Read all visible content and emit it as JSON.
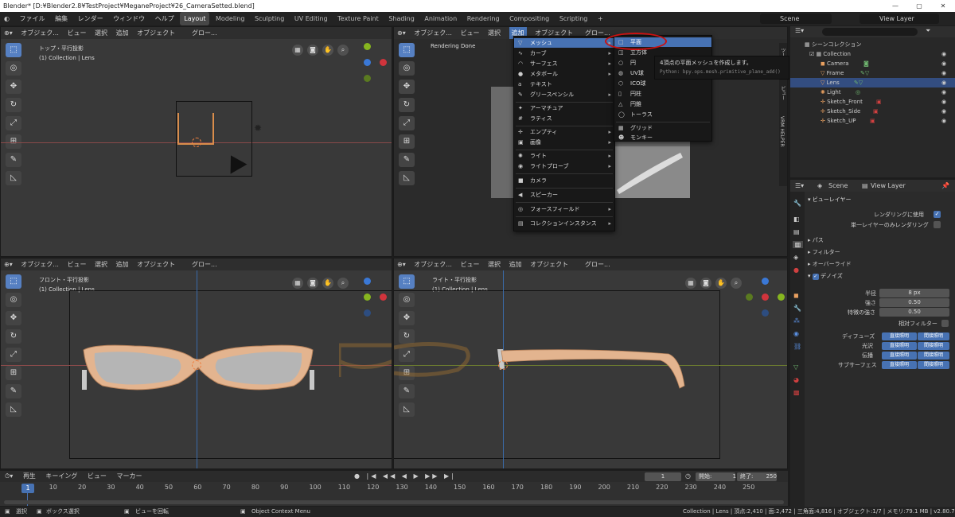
{
  "titlebar": {
    "title": "Blender* [D:¥Blender2.8¥TestProject¥MeganeProject¥26_CameraSetted.blend]",
    "minimize": "—",
    "maximize": "▢",
    "close": "✕"
  },
  "menubar": {
    "logo": "◐",
    "items": [
      "ファイル",
      "編集",
      "レンダー",
      "ウィンドウ",
      "ヘルプ"
    ],
    "workspaces": [
      "Layout",
      "Modeling",
      "Sculpting",
      "UV Editing",
      "Texture Paint",
      "Shading",
      "Animation",
      "Rendering",
      "Compositing",
      "Scripting"
    ],
    "add_tab": "+",
    "scene": "Scene",
    "view_layer": "View Layer"
  },
  "viewports": {
    "top": {
      "title": "トップ・平行投影",
      "subtitle": "(1) Collection | Lens",
      "menus": [
        "オブジェク...",
        "ビュー",
        "選択",
        "追加",
        "オブジェクト"
      ],
      "orient": "グロー..."
    },
    "camera": {
      "title": "Rendering Done",
      "menus": [
        "オブジェク...",
        "ビュー",
        "選択",
        "追加",
        "オブジェクト"
      ],
      "orient": "グロー..."
    },
    "front": {
      "title": "フロント・平行投影",
      "subtitle": "(1) Collection | Lens",
      "menus": [
        "オブジェク...",
        "ビュー",
        "選択",
        "追加",
        "オブジェクト"
      ],
      "orient": "グロー..."
    },
    "right": {
      "title": "ライト・平行投影",
      "subtitle": "(1) Collection | Lens",
      "menus": [
        "オブジェク...",
        "ビュー",
        "選択",
        "追加",
        "オブジェクト"
      ],
      "orient": "グロー..."
    }
  },
  "add_menu": {
    "items": [
      {
        "label": "メッシュ",
        "icon": "▽",
        "sub": true,
        "hl": true
      },
      {
        "label": "カーブ",
        "icon": "∿",
        "sub": true
      },
      {
        "label": "サーフェス",
        "icon": "◠",
        "sub": true
      },
      {
        "label": "メタボール",
        "icon": "●",
        "sub": true
      },
      {
        "label": "テキスト",
        "icon": "a",
        "sub": false
      },
      {
        "label": "グリースペンシル",
        "icon": "✎",
        "sub": true
      },
      {
        "label": "アーマチュア",
        "icon": "✦",
        "sub": false
      },
      {
        "label": "ラティス",
        "icon": "#",
        "sub": false
      },
      {
        "label": "エンプティ",
        "icon": "✛",
        "sub": true
      },
      {
        "label": "画像",
        "icon": "▣",
        "sub": true
      },
      {
        "label": "ライト",
        "icon": "✺",
        "sub": true
      },
      {
        "label": "ライトプローブ",
        "icon": "◉",
        "sub": true
      },
      {
        "label": "カメラ",
        "icon": "■",
        "sub": false
      },
      {
        "label": "スピーカー",
        "icon": "◀",
        "sub": false
      },
      {
        "label": "フォースフィールド",
        "icon": "◎",
        "sub": true
      },
      {
        "label": "コレクションインスタンス",
        "icon": "▤",
        "sub": true
      }
    ]
  },
  "mesh_menu": {
    "items": [
      {
        "label": "平面",
        "icon": "□"
      },
      {
        "label": "立方体",
        "icon": "◫"
      },
      {
        "label": "円",
        "icon": "○"
      },
      {
        "label": "UV球",
        "icon": "◍"
      },
      {
        "label": "ICO球",
        "icon": "⬡"
      },
      {
        "label": "円柱",
        "icon": "▯"
      },
      {
        "label": "円錐",
        "icon": "△"
      },
      {
        "label": "トーラス",
        "icon": "◯"
      },
      {
        "label": "グリッド",
        "icon": "▦"
      },
      {
        "label": "モンキー",
        "icon": "☻"
      }
    ]
  },
  "tooltip": {
    "text": "4頂点の平面メッシュを作成します。",
    "python": "Python: bpy.ops.mesh.primitive_plane_add()"
  },
  "side_tabs": [
    "ツール",
    "ビュー",
    "VRM HELPER"
  ],
  "outliner": {
    "header": "シーンコレクション",
    "rows": [
      {
        "label": "Collection",
        "indent": 1,
        "sel": false,
        "icon_color": "#ddd"
      },
      {
        "label": "Camera",
        "indent": 2,
        "sel": false,
        "icon_color": "#e8a060"
      },
      {
        "label": "Frame",
        "indent": 2,
        "sel": false,
        "icon_color": "#e8a060"
      },
      {
        "label": "Lens",
        "indent": 2,
        "sel": true,
        "icon_color": "#e8a060"
      },
      {
        "label": "Light",
        "indent": 2,
        "sel": false,
        "icon_color": "#e8a060"
      },
      {
        "label": "Sketch_Front",
        "indent": 2,
        "sel": false,
        "icon_color": "#e8a060"
      },
      {
        "label": "Sketch_Side",
        "indent": 2,
        "sel": false,
        "icon_color": "#e8a060"
      },
      {
        "label": "Sketch_UP",
        "indent": 2,
        "sel": false,
        "icon_color": "#e8a060"
      }
    ]
  },
  "properties": {
    "scene": "Scene",
    "view_layer": "View Layer",
    "panel": "ビューレイヤー",
    "use_render": "レンダリングに使用",
    "single_layer": "単一レイヤーのみレンダリング",
    "sections": [
      "パス",
      "フィルター",
      "オーバーライド"
    ],
    "denoise": "デノイズ",
    "fields": [
      {
        "label": "半径",
        "value": "8 px"
      },
      {
        "label": "強さ",
        "value": "0.50"
      },
      {
        "label": "特徴の強さ",
        "value": "0.50"
      }
    ],
    "relative": "相対フィルター",
    "passes": [
      {
        "label": "ディフューズ",
        "a": "直接照明",
        "b": "間接照明"
      },
      {
        "label": "光沢",
        "a": "直接照明",
        "b": "間接照明"
      },
      {
        "label": "伝播",
        "a": "直接照明",
        "b": "間接照明"
      },
      {
        "label": "サブサーフェス",
        "a": "直接照明",
        "b": "間接照明"
      }
    ]
  },
  "timeline": {
    "menus": [
      "再生",
      "キーイング",
      "ビュー",
      "マーカー"
    ],
    "current": "1",
    "frame_field": "1",
    "start_label": "開始:",
    "start": "1",
    "end_label": "終了:",
    "end": "250",
    "ticks": [
      "1",
      "10",
      "20",
      "30",
      "40",
      "50",
      "60",
      "70",
      "80",
      "90",
      "100",
      "110",
      "120",
      "130",
      "140",
      "150",
      "160",
      "170",
      "180",
      "190",
      "200",
      "210",
      "220",
      "230",
      "240",
      "250"
    ]
  },
  "statusbar": {
    "select": "選択",
    "box": "ボックス選択",
    "rotate": "ビューを回転",
    "context": "Object Context Menu",
    "stats": "Collection | Lens | 頂点:2,410 | 面:2,472 | 三角面:4,816 | オブジェクト:1/7 | メモリ:79.1 MB | v2.80.75"
  },
  "colors": {
    "accent": "#4772b3",
    "highlight_ring": "#cc1111",
    "frame": "#e3b48f",
    "lens": "#b5b5b5"
  }
}
